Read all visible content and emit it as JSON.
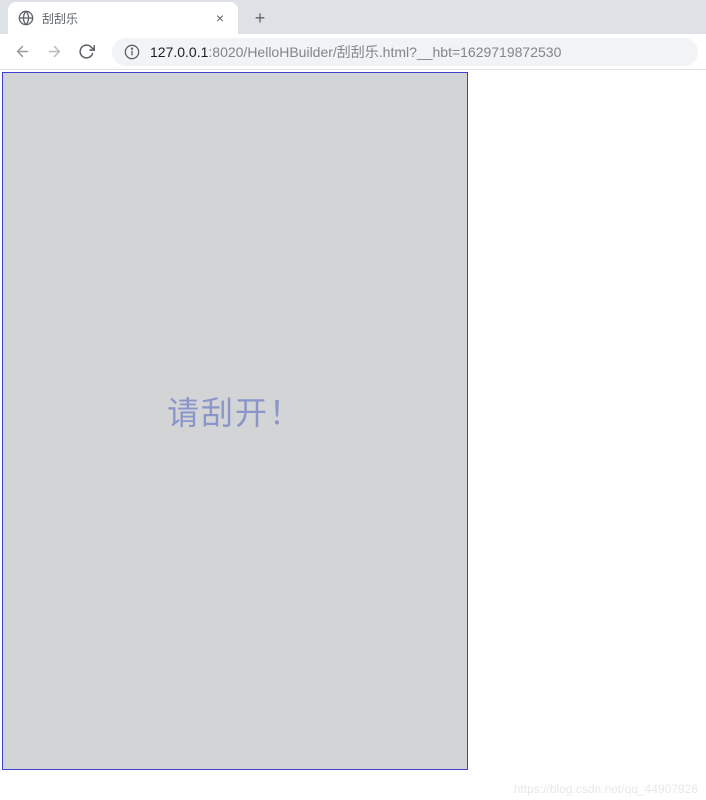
{
  "browser": {
    "tab": {
      "title": "刮刮乐",
      "close_label": "×"
    },
    "new_tab_label": "+",
    "url": {
      "host": "127.0.0.1",
      "rest": ":8020/HelloHBuilder/刮刮乐.html?__hbt=1629719872530"
    }
  },
  "page": {
    "scratch_prompt": "请刮开！"
  },
  "watermark": "https://blog.csdn.net/qq_44907926"
}
